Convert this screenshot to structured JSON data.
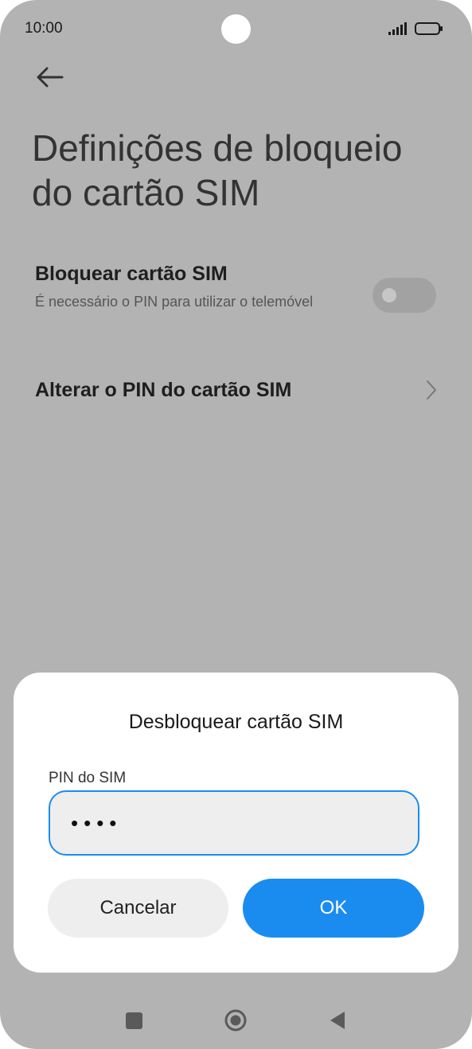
{
  "status_bar": {
    "time": "10:00"
  },
  "header": {
    "title": "Definições de bloqueio do cartão SIM"
  },
  "settings": {
    "lock_sim": {
      "title": "Bloquear cartão SIM",
      "subtitle": "É necessário o PIN para utilizar o telemóvel",
      "enabled": false
    },
    "change_pin": {
      "title": "Alterar o PIN do cartão SIM"
    }
  },
  "dialog": {
    "title": "Desbloquear cartão SIM",
    "field_label": "PIN do SIM",
    "pin_value": "••••",
    "cancel_label": "Cancelar",
    "ok_label": "OK"
  },
  "colors": {
    "accent": "#1a8cf0",
    "dim_background": "#b3b3b3",
    "dialog_background": "#ffffff"
  },
  "icons": [
    "back-arrow-icon",
    "signal-icon",
    "battery-icon",
    "chevron-right-icon",
    "recents-icon",
    "home-icon",
    "nav-back-icon"
  ]
}
